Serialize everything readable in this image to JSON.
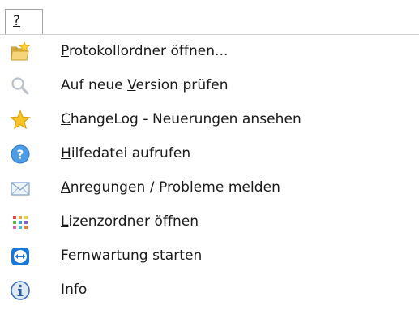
{
  "menubar": {
    "help_menu_label": "?"
  },
  "menu": {
    "items": [
      {
        "pre": "",
        "accel": "P",
        "post": "rotokollordner öffnen...",
        "icon": "folder-star-icon"
      },
      {
        "pre": "Auf neue ",
        "accel": "V",
        "post": "ersion prüfen",
        "icon": "search-icon"
      },
      {
        "pre": "",
        "accel": "C",
        "post": "hangeLog - Neuerungen ansehen",
        "icon": "star-icon"
      },
      {
        "pre": "",
        "accel": "H",
        "post": "ilfedatei aufrufen",
        "icon": "help-icon"
      },
      {
        "pre": "",
        "accel": "A",
        "post": "nregungen / Probleme melden",
        "icon": "mail-icon"
      },
      {
        "pre": "",
        "accel": "L",
        "post": "izenzordner öffnen",
        "icon": "license-grid-icon"
      },
      {
        "pre": "",
        "accel": "F",
        "post": "ernwartung starten",
        "icon": "teamviewer-icon"
      },
      {
        "pre": "",
        "accel": "I",
        "post": "nfo",
        "icon": "info-icon"
      }
    ]
  }
}
